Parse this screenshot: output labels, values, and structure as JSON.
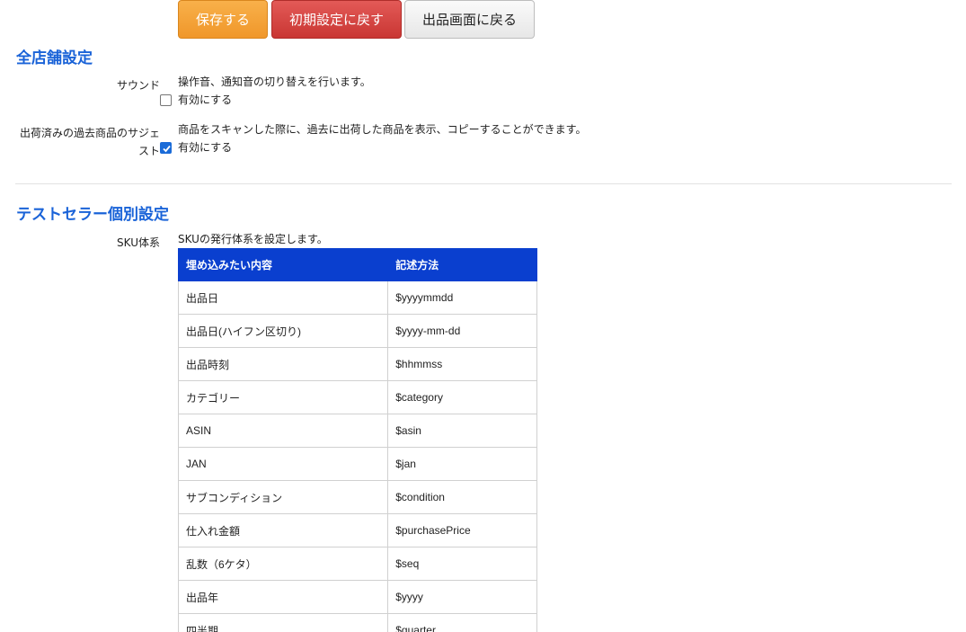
{
  "toolbar": {
    "save_label": "保存する",
    "reset_label": "初期設定に戻す",
    "back_label": "出品画面に戻る"
  },
  "all_stores": {
    "title": "全店舗設定",
    "sound": {
      "label": "サウンド",
      "description": "操作音、通知音の切り替えを行います。",
      "checkbox_label": "有効にする",
      "checked": false
    },
    "suggest": {
      "label_line1": "出荷済みの過去商品のサジェ",
      "label_line2": "スト",
      "description": "商品をスキャンした際に、過去に出荷した商品を表示、コピーすることができます。",
      "checkbox_label": "有効にする",
      "checked": true
    }
  },
  "seller": {
    "title": "テストセラー個別設定",
    "sku": {
      "label": "SKU体系",
      "description": "SKUの発行体系を設定します。",
      "table": {
        "headers": [
          "埋め込みたい内容",
          "記述方法"
        ],
        "rows": [
          [
            "出品日",
            "$yyyymmdd"
          ],
          [
            "出品日(ハイフン区切り)",
            "$yyyy-mm-dd"
          ],
          [
            "出品時刻",
            "$hhmmss"
          ],
          [
            "カテゴリー",
            "$category"
          ],
          [
            "ASIN",
            "$asin"
          ],
          [
            "JAN",
            "$jan"
          ],
          [
            "サブコンディション",
            "$condition"
          ],
          [
            "仕入れ金額",
            "$purchasePrice"
          ],
          [
            "乱数（6ケタ）",
            "$seq"
          ],
          [
            "出品年",
            "$yyyy"
          ],
          [
            "四半期",
            "$quarter"
          ]
        ]
      }
    }
  },
  "colors": {
    "section_title": "#1a63d8",
    "table_header": "#0a3fcf",
    "save_button": "#f0972a",
    "reset_button": "#c93633"
  }
}
